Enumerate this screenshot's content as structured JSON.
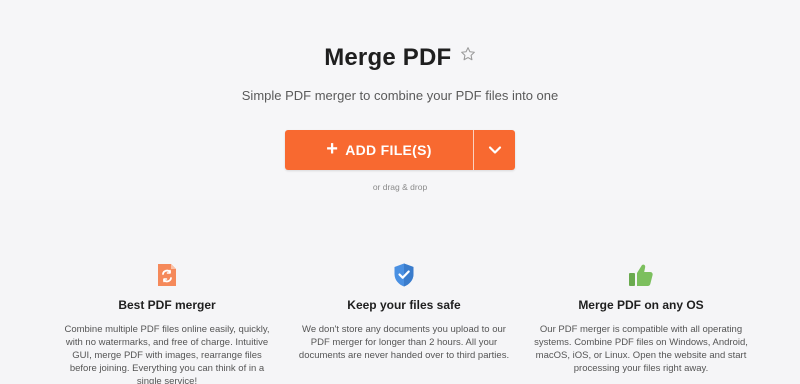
{
  "header": {
    "title": "Merge PDF",
    "subtitle": "Simple PDF merger to combine your PDF files into one"
  },
  "upload": {
    "add_files_label": "ADD FILE(S)",
    "plus_glyph": "+",
    "drag_hint": "or drag & drop",
    "accent_color": "#f86930"
  },
  "features": [
    {
      "icon": "refresh-document-icon",
      "title": "Best PDF merger",
      "description": "Combine multiple PDF files online easily, quickly, with no watermarks, and free of charge. Intuitive GUI, merge PDF with images, rearrange files before joining. Everything you can think of in a single service!"
    },
    {
      "icon": "shield-check-icon",
      "title": "Keep your files safe",
      "description": "We don't store any documents you upload to our PDF merger for longer than 2 hours. All your documents are never handed over to third parties."
    },
    {
      "icon": "thumbs-up-icon",
      "title": "Merge PDF on any OS",
      "description": "Our PDF merger is compatible with all operating systems. Combine PDF files on Windows, Android, macOS, iOS, or Linux. Open the website and start processing your files right away."
    }
  ]
}
